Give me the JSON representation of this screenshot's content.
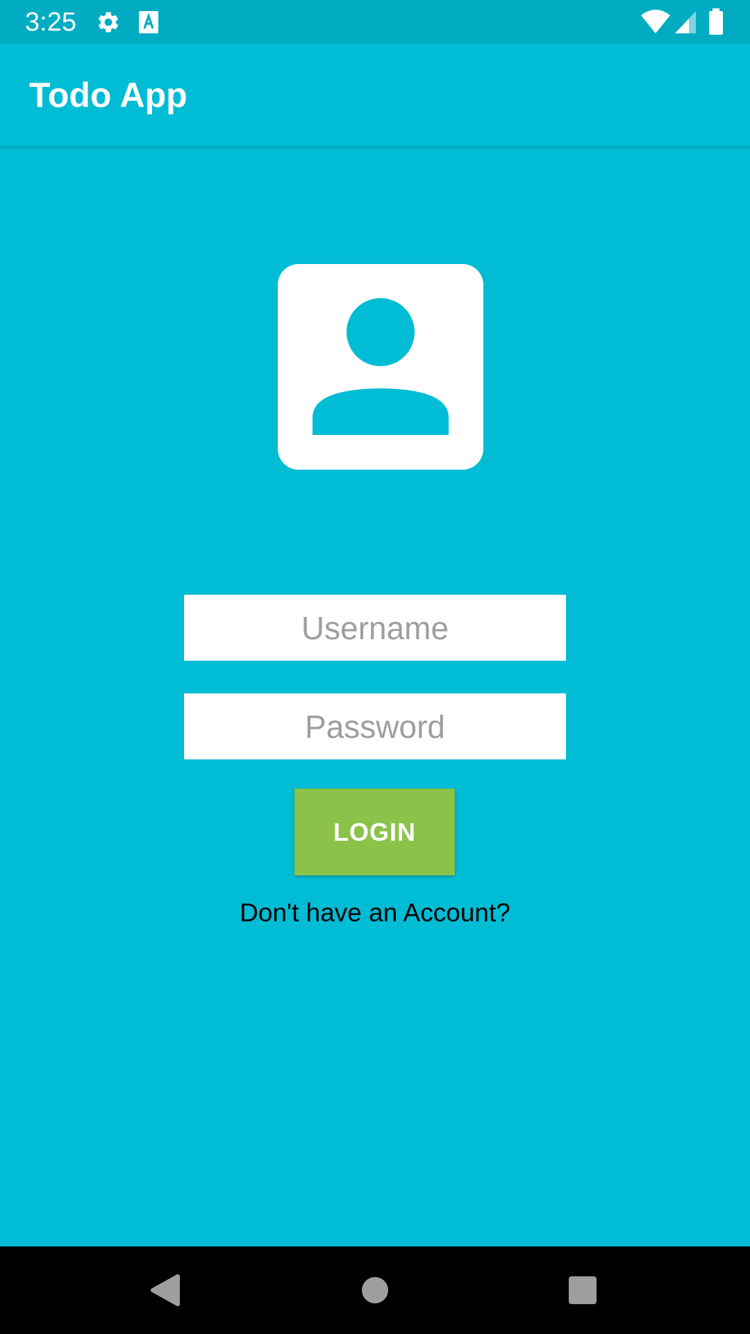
{
  "status_bar": {
    "time": "3:25",
    "left_icons": [
      "gear-icon",
      "font-a-icon"
    ],
    "right_icons": [
      "wifi-icon",
      "cell-signal-icon",
      "battery-icon"
    ]
  },
  "app_bar": {
    "title": "Todo App"
  },
  "avatar": {
    "icon": "account-box-icon"
  },
  "form": {
    "username_placeholder": "Username",
    "username_value": "",
    "password_placeholder": "Password",
    "password_value": "",
    "login_label": "LOGIN",
    "signup_link": "Don't have an Account?"
  },
  "nav_bar": {
    "buttons": [
      "back-icon",
      "home-icon",
      "recents-icon"
    ]
  },
  "colors": {
    "background": "#00bcd4",
    "status_bar": "#00acc1",
    "login_button": "#8bc34a",
    "placeholder_text": "#9e9e9e"
  }
}
